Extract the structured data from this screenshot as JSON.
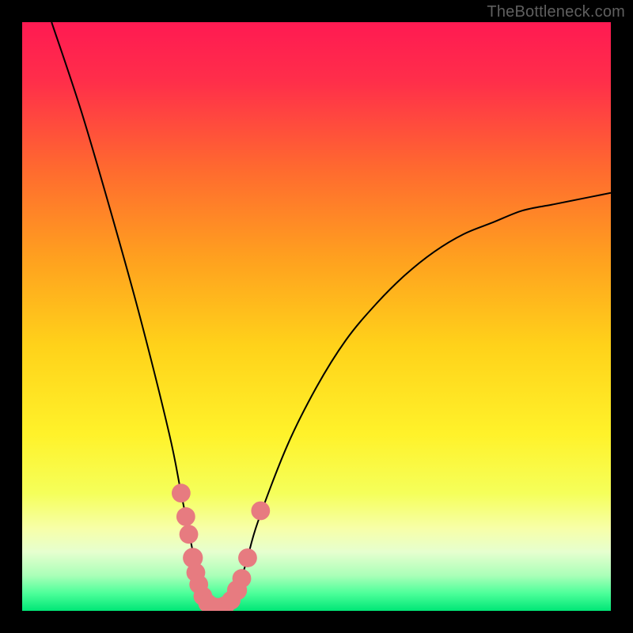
{
  "watermark": "TheBottleneck.com",
  "chart_data": {
    "type": "line",
    "title": "",
    "xlabel": "",
    "ylabel": "",
    "xlim": [
      0,
      100
    ],
    "ylim": [
      0,
      100
    ],
    "series": [
      {
        "name": "bottleneck-curve",
        "x": [
          5,
          10,
          15,
          20,
          25,
          27,
          29,
          30,
          31,
          32,
          33,
          34,
          35,
          36,
          38,
          40,
          45,
          50,
          55,
          60,
          65,
          70,
          75,
          80,
          85,
          90,
          95,
          100
        ],
        "values": [
          100,
          85,
          68,
          50,
          30,
          20,
          10,
          5,
          2,
          0,
          0,
          0,
          0,
          2,
          8,
          15,
          28,
          38,
          46,
          52,
          57,
          61,
          64,
          66,
          68,
          69,
          70,
          71
        ]
      }
    ],
    "markers": [
      {
        "x": 27.0,
        "y": 20.0,
        "color": "#e77b80",
        "r": 1.6
      },
      {
        "x": 27.8,
        "y": 16.0,
        "color": "#e77b80",
        "r": 1.6
      },
      {
        "x": 28.3,
        "y": 13.0,
        "color": "#e77b80",
        "r": 1.6
      },
      {
        "x": 29.0,
        "y": 9.0,
        "color": "#e77b80",
        "r": 1.7
      },
      {
        "x": 29.5,
        "y": 6.5,
        "color": "#e77b80",
        "r": 1.6
      },
      {
        "x": 30.0,
        "y": 4.5,
        "color": "#e77b80",
        "r": 1.6
      },
      {
        "x": 30.7,
        "y": 2.5,
        "color": "#e77b80",
        "r": 1.6
      },
      {
        "x": 31.5,
        "y": 1.3,
        "color": "#e77b80",
        "r": 1.6
      },
      {
        "x": 32.5,
        "y": 0.7,
        "color": "#e77b80",
        "r": 1.6
      },
      {
        "x": 33.5,
        "y": 0.6,
        "color": "#e77b80",
        "r": 1.6
      },
      {
        "x": 34.5,
        "y": 0.9,
        "color": "#e77b80",
        "r": 1.6
      },
      {
        "x": 35.5,
        "y": 1.8,
        "color": "#e77b80",
        "r": 1.6
      },
      {
        "x": 36.5,
        "y": 3.5,
        "color": "#e77b80",
        "r": 1.7
      },
      {
        "x": 37.3,
        "y": 5.5,
        "color": "#e77b80",
        "r": 1.6
      },
      {
        "x": 38.3,
        "y": 9.0,
        "color": "#e77b80",
        "r": 1.6
      },
      {
        "x": 40.5,
        "y": 17.0,
        "color": "#e77b80",
        "r": 1.6
      }
    ],
    "gradient_stops": [
      {
        "offset": 0.0,
        "color": "#ff1a52"
      },
      {
        "offset": 0.1,
        "color": "#ff2e4a"
      },
      {
        "offset": 0.25,
        "color": "#ff6a2f"
      },
      {
        "offset": 0.4,
        "color": "#ffa01f"
      },
      {
        "offset": 0.55,
        "color": "#ffd21a"
      },
      {
        "offset": 0.7,
        "color": "#fff22a"
      },
      {
        "offset": 0.8,
        "color": "#f5ff5a"
      },
      {
        "offset": 0.86,
        "color": "#f7ffa8"
      },
      {
        "offset": 0.9,
        "color": "#e6ffcf"
      },
      {
        "offset": 0.94,
        "color": "#aaffb8"
      },
      {
        "offset": 0.97,
        "color": "#4dff9a"
      },
      {
        "offset": 1.0,
        "color": "#00e676"
      }
    ]
  }
}
